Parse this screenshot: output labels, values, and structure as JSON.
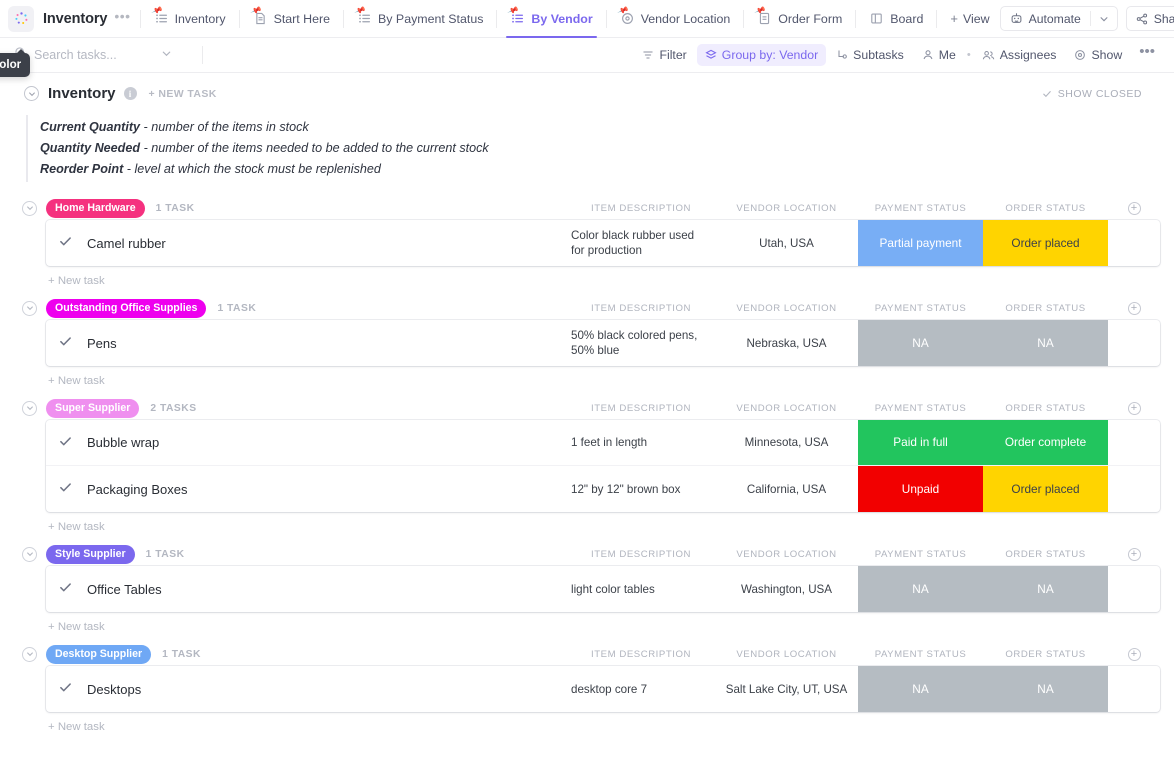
{
  "topbar": {
    "list_title": "Inventory",
    "more_label": "•••",
    "views": [
      {
        "label": "Inventory",
        "icon": "list-icon",
        "active": false,
        "pinned": true
      },
      {
        "label": "Start Here",
        "icon": "doc-icon",
        "active": false,
        "pinned": true
      },
      {
        "label": "By Payment Status",
        "icon": "list-icon",
        "active": false,
        "pinned": true
      },
      {
        "label": "By Vendor",
        "icon": "list-icon",
        "active": true,
        "pinned": true
      },
      {
        "label": "Vendor Location",
        "icon": "map-pin-icon",
        "active": false,
        "pinned": true
      },
      {
        "label": "Order Form",
        "icon": "form-icon",
        "active": false,
        "pinned": true
      },
      {
        "label": "Board",
        "icon": "board-icon",
        "active": false,
        "pinned": false
      }
    ],
    "add_view": "View",
    "automate": "Automate",
    "share": "Share"
  },
  "toolbar": {
    "search_placeholder": "Search tasks...",
    "search_value": "",
    "tooltip": "List color",
    "filter": "Filter",
    "group_by": "Group by: Vendor",
    "subtasks": "Subtasks",
    "me": "Me",
    "assignees": "Assignees",
    "show": "Show",
    "more": "•••"
  },
  "page": {
    "title": "Inventory",
    "info_glyph": "i",
    "new_task": "+ NEW TASK",
    "show_closed": "SHOW CLOSED",
    "description": [
      {
        "term": "Current Quantity",
        "rest": " - number of the items in stock"
      },
      {
        "term": "Quantity Needed",
        "rest": " - number of the items needed to be added to the current stock"
      },
      {
        "term": "Reorder Point",
        "rest": " - level at which the stock must be replenished"
      }
    ]
  },
  "columns": {
    "item_description": "ITEM DESCRIPTION",
    "vendor_location": "VENDOR LOCATION",
    "payment_status": "PAYMENT STATUS",
    "order_status": "ORDER STATUS"
  },
  "new_task_label": "+ New task",
  "colors": {
    "accent": "#7b68ee",
    "home_hardware": "#f5317f",
    "outstanding_office_supplies": "#ee00ee",
    "super_supplier": "#ef8fef",
    "style_supplier": "#7b68ee",
    "desktop_supplier": "#6fa8f5",
    "status_na": "#b5bcc2",
    "status_partial": "#78aef5",
    "status_order_placed": "#ffd400",
    "status_paid": "#22c55e",
    "status_complete": "#22c55e",
    "status_unpaid": "#f20000"
  },
  "groups": [
    {
      "name": "Home Hardware",
      "badge_color": "#f5317f",
      "count": "1 TASK",
      "tasks": [
        {
          "name": "Camel rubber",
          "item_description": "Color black rubber used for production",
          "vendor_location": "Utah, USA",
          "payment_status": "Partial payment",
          "payment_color": "#78aef5",
          "payment_text_color": "#ffffff",
          "order_status": "Order placed",
          "order_color": "#ffd400",
          "order_text_color": "#3c4149"
        }
      ]
    },
    {
      "name": "Outstanding Office Supplies",
      "badge_color": "#ee00ee",
      "count": "1 TASK",
      "tasks": [
        {
          "name": "Pens",
          "item_description": "50% black colored pens, 50% blue",
          "vendor_location": "Nebraska, USA",
          "payment_status": "NA",
          "payment_color": "#b5bcc2",
          "payment_text_color": "#ffffff",
          "order_status": "NA",
          "order_color": "#b5bcc2",
          "order_text_color": "#ffffff"
        }
      ]
    },
    {
      "name": "Super Supplier",
      "badge_color": "#ef8fef",
      "count": "2 TASKS",
      "tasks": [
        {
          "name": "Bubble wrap",
          "item_description": "1 feet in length",
          "vendor_location": "Minnesota, USA",
          "payment_status": "Paid in full",
          "payment_color": "#22c55e",
          "payment_text_color": "#ffffff",
          "order_status": "Order complete",
          "order_color": "#22c55e",
          "order_text_color": "#ffffff"
        },
        {
          "name": "Packaging Boxes",
          "item_description": "12\" by 12\" brown box",
          "vendor_location": "California, USA",
          "payment_status": "Unpaid",
          "payment_color": "#f20000",
          "payment_text_color": "#ffffff",
          "order_status": "Order placed",
          "order_color": "#ffd400",
          "order_text_color": "#3c4149"
        }
      ]
    },
    {
      "name": "Style Supplier",
      "badge_color": "#7b68ee",
      "count": "1 TASK",
      "tasks": [
        {
          "name": "Office Tables",
          "item_description": "light color tables",
          "vendor_location": "Washington, USA",
          "payment_status": "NA",
          "payment_color": "#b5bcc2",
          "payment_text_color": "#ffffff",
          "order_status": "NA",
          "order_color": "#b5bcc2",
          "order_text_color": "#ffffff"
        }
      ]
    },
    {
      "name": "Desktop Supplier",
      "badge_color": "#6fa8f5",
      "count": "1 TASK",
      "tasks": [
        {
          "name": "Desktops",
          "item_description": "desktop core 7",
          "vendor_location": "Salt Lake City, UT, USA",
          "payment_status": "NA",
          "payment_color": "#b5bcc2",
          "payment_text_color": "#ffffff",
          "order_status": "NA",
          "order_color": "#b5bcc2",
          "order_text_color": "#ffffff"
        }
      ]
    }
  ]
}
